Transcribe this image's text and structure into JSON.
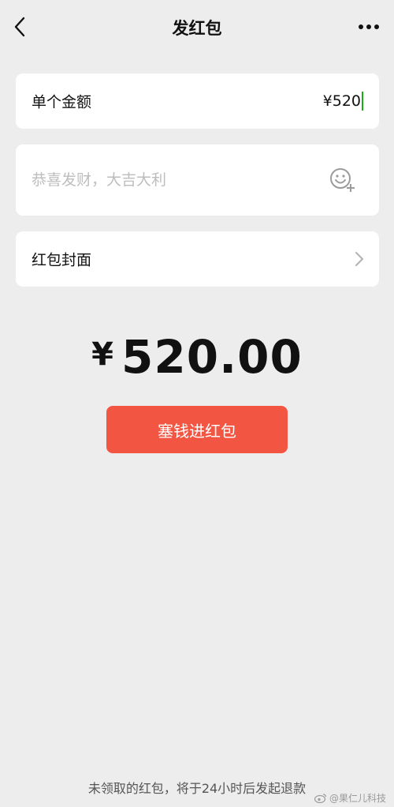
{
  "header": {
    "title": "发红包",
    "back_icon": "chevron-left-icon",
    "more_icon": "more-dots-icon"
  },
  "amount_row": {
    "label": "单个金额",
    "value": "¥520"
  },
  "greeting": {
    "placeholder": "恭喜发财，大吉大利",
    "emoji_icon": "emoji-add-icon"
  },
  "cover_row": {
    "label": "红包封面",
    "chevron_icon": "chevron-right-icon"
  },
  "total": {
    "currency": "¥",
    "amount": "520.00"
  },
  "send_button": {
    "label": "塞钱进红包"
  },
  "footer": {
    "note": "未领取的红包，将于24小时后发起退款"
  },
  "watermark": {
    "text": "@果仁儿科技"
  },
  "colors": {
    "background": "#ededed",
    "card": "#ffffff",
    "button": "#f25542",
    "caret": "#1aad19"
  }
}
